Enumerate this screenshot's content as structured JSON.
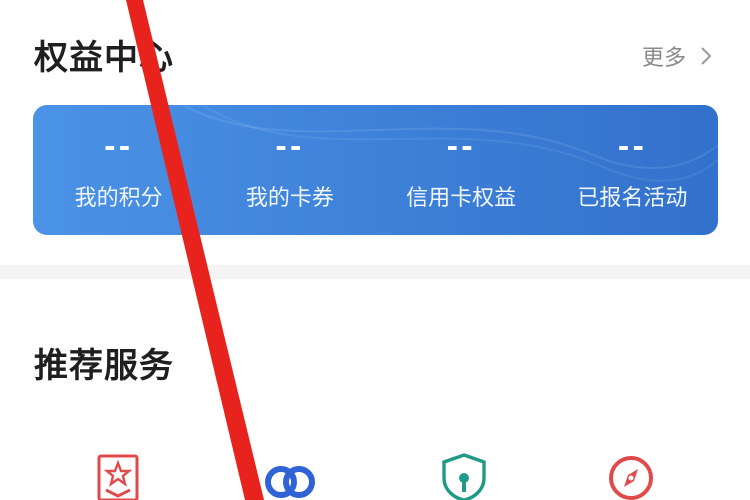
{
  "rights": {
    "title": "权益中心",
    "more_label": "更多",
    "items": [
      {
        "value": "--",
        "label": "我的积分"
      },
      {
        "value": "--",
        "label": "我的卡券"
      },
      {
        "value": "--",
        "label": "信用卡权益"
      },
      {
        "value": "--",
        "label": "已报名活动"
      }
    ]
  },
  "services": {
    "title": "推荐服务",
    "icons": [
      "ribbon-star-icon",
      "link-chain-icon",
      "shield-lock-icon",
      "compass-icon"
    ]
  },
  "colors": {
    "card_start": "#4b93e6",
    "card_end": "#3271cc",
    "annotation": "#e8231d"
  }
}
